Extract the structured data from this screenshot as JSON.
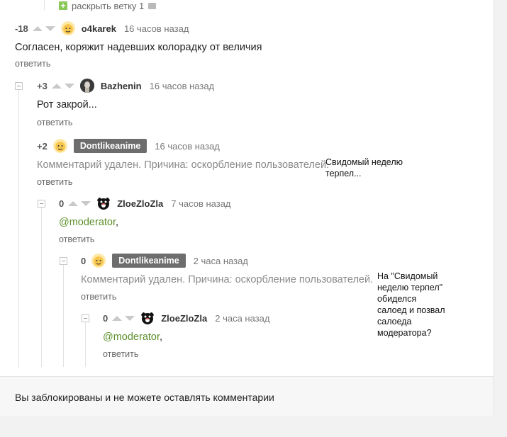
{
  "expand_branch": {
    "label": "раскрыть ветку 1"
  },
  "comments": [
    {
      "rating": "-18",
      "author": "o4karek",
      "time": "16 часов назад",
      "text": "Согласен, коряжит надевших колорадку от величия",
      "reply": "ответить"
    },
    {
      "rating": "+3",
      "author": "Bazhenin",
      "time": "16 часов назад",
      "text": "Рот закрой...",
      "reply": "ответить"
    },
    {
      "rating": "+2",
      "author": "Dontlikeanime",
      "time": "16 часов назад",
      "text": "Комментарий удален. Причина: оскорбление пользователей.",
      "reply": "ответить"
    },
    {
      "rating": "0",
      "author": "ZloeZloZla",
      "time": "7 часов назад",
      "mention": "@moderator",
      "suffix": ",",
      "reply": "ответить"
    },
    {
      "rating": "0",
      "author": "Dontlikeanime",
      "time": "2 часа назад",
      "text": "Комментарий удален. Причина: оскорбление пользователей.",
      "reply": "ответить"
    },
    {
      "rating": "0",
      "author": "ZloeZloZla",
      "time": "2 часа назад",
      "mention": "@moderator",
      "suffix": ",",
      "reply": "ответить"
    }
  ],
  "annotations": [
    "Свидомый неделю\nтерпел...",
    "На \"Свидомый\nнеделю терпел\"\nобиделся\nсалоед и позвал\nсалоеда\nмодератора?"
  ],
  "footer": {
    "text": "Вы заблокированы и не можете оставлять комментарии"
  },
  "icons": {
    "expand": "plus-icon",
    "comment": "comment-icon",
    "upvote": "arrow-up-icon",
    "downvote": "arrow-down-icon",
    "collapse": "collapse-icon"
  },
  "colors": {
    "mention": "#5b8f2a",
    "badge": "#6d6d6d",
    "expand_icon": "#8ac858"
  }
}
